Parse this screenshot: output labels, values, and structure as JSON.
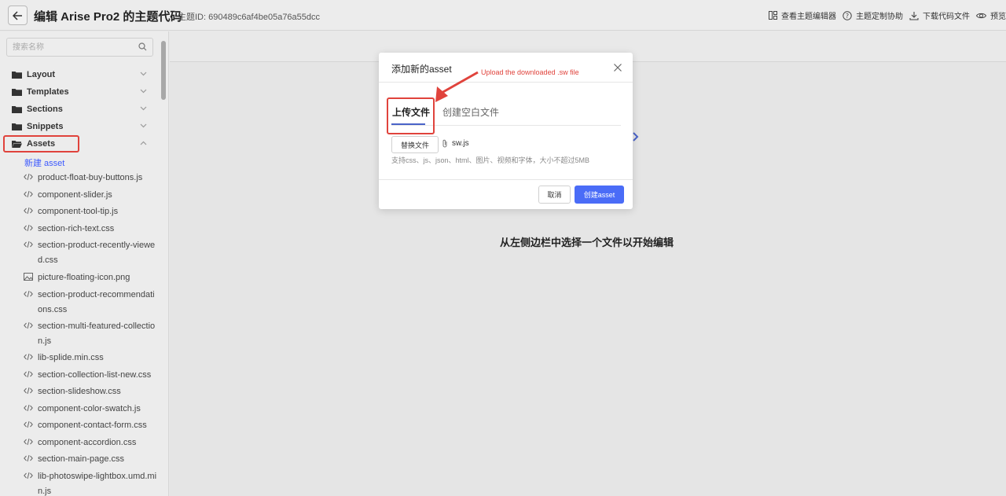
{
  "header": {
    "title": "编辑 Arise Pro2 的主题代码",
    "theme_id": "主题ID: 690489c6af4be05a76a55dcc",
    "actions": {
      "view_editor": "查看主题编辑器",
      "help": "主题定制协助",
      "download": "下载代码文件",
      "preview": "预览"
    }
  },
  "sidebar": {
    "search_placeholder": "搜索名称",
    "folders": {
      "layout": "Layout",
      "templates": "Templates",
      "sections": "Sections",
      "snippets": "Snippets",
      "assets": "Assets"
    },
    "new_asset": "新建 asset",
    "files": [
      "product-float-buy-buttons.js",
      "component-slider.js",
      "component-tool-tip.js",
      "section-rich-text.css",
      "section-product-recently-viewed.css",
      "picture-floating-icon.png",
      "section-product-recommendations.css",
      "section-multi-featured-collection.js",
      "lib-splide.min.css",
      "section-collection-list-new.css",
      "section-slideshow.css",
      "component-color-swatch.js",
      "component-contact-form.css",
      "component-accordion.css",
      "section-main-page.css",
      "lib-photoswipe-lightbox.umd.min.js"
    ]
  },
  "main": {
    "empty_hint": "从左侧边栏中选择一个文件以开始编辑"
  },
  "modal": {
    "title": "添加新的asset",
    "tab_upload": "上传文件",
    "tab_blank": "创建空白文件",
    "replace_button": "替换文件",
    "file_name": "sw.js",
    "hint": "支持css、js、json、html、图片、视频和字体，大小不超过5MB",
    "cancel": "取消",
    "create": "创建asset"
  },
  "annotation": {
    "text": "Upload the downloaded .sw file"
  },
  "colors": {
    "accent": "#4a6cf7",
    "link": "#3d5afe",
    "annotation_red": "#e0433c"
  }
}
